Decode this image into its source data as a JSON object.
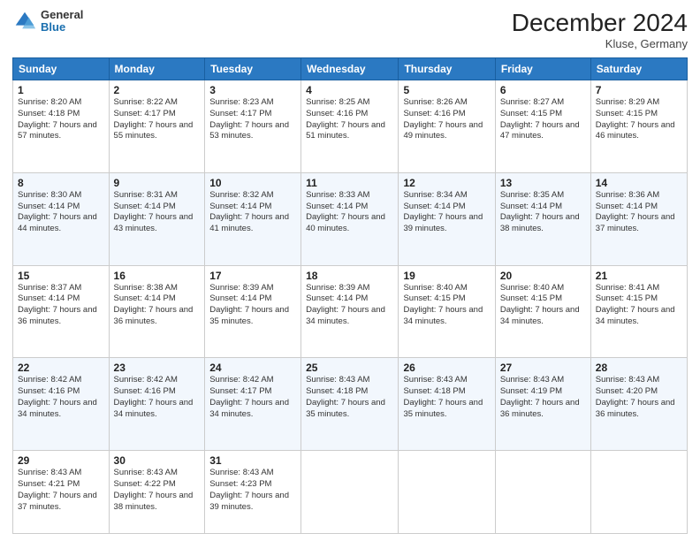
{
  "header": {
    "logo_general": "General",
    "logo_blue": "Blue",
    "month_title": "December 2024",
    "location": "Kluse, Germany"
  },
  "weekdays": [
    "Sunday",
    "Monday",
    "Tuesday",
    "Wednesday",
    "Thursday",
    "Friday",
    "Saturday"
  ],
  "weeks": [
    [
      {
        "day": "1",
        "sunrise": "8:20 AM",
        "sunset": "4:18 PM",
        "daylight": "7 hours and 57 minutes."
      },
      {
        "day": "2",
        "sunrise": "8:22 AM",
        "sunset": "4:17 PM",
        "daylight": "7 hours and 55 minutes."
      },
      {
        "day": "3",
        "sunrise": "8:23 AM",
        "sunset": "4:17 PM",
        "daylight": "7 hours and 53 minutes."
      },
      {
        "day": "4",
        "sunrise": "8:25 AM",
        "sunset": "4:16 PM",
        "daylight": "7 hours and 51 minutes."
      },
      {
        "day": "5",
        "sunrise": "8:26 AM",
        "sunset": "4:16 PM",
        "daylight": "7 hours and 49 minutes."
      },
      {
        "day": "6",
        "sunrise": "8:27 AM",
        "sunset": "4:15 PM",
        "daylight": "7 hours and 47 minutes."
      },
      {
        "day": "7",
        "sunrise": "8:29 AM",
        "sunset": "4:15 PM",
        "daylight": "7 hours and 46 minutes."
      }
    ],
    [
      {
        "day": "8",
        "sunrise": "8:30 AM",
        "sunset": "4:14 PM",
        "daylight": "7 hours and 44 minutes."
      },
      {
        "day": "9",
        "sunrise": "8:31 AM",
        "sunset": "4:14 PM",
        "daylight": "7 hours and 43 minutes."
      },
      {
        "day": "10",
        "sunrise": "8:32 AM",
        "sunset": "4:14 PM",
        "daylight": "7 hours and 41 minutes."
      },
      {
        "day": "11",
        "sunrise": "8:33 AM",
        "sunset": "4:14 PM",
        "daylight": "7 hours and 40 minutes."
      },
      {
        "day": "12",
        "sunrise": "8:34 AM",
        "sunset": "4:14 PM",
        "daylight": "7 hours and 39 minutes."
      },
      {
        "day": "13",
        "sunrise": "8:35 AM",
        "sunset": "4:14 PM",
        "daylight": "7 hours and 38 minutes."
      },
      {
        "day": "14",
        "sunrise": "8:36 AM",
        "sunset": "4:14 PM",
        "daylight": "7 hours and 37 minutes."
      }
    ],
    [
      {
        "day": "15",
        "sunrise": "8:37 AM",
        "sunset": "4:14 PM",
        "daylight": "7 hours and 36 minutes."
      },
      {
        "day": "16",
        "sunrise": "8:38 AM",
        "sunset": "4:14 PM",
        "daylight": "7 hours and 36 minutes."
      },
      {
        "day": "17",
        "sunrise": "8:39 AM",
        "sunset": "4:14 PM",
        "daylight": "7 hours and 35 minutes."
      },
      {
        "day": "18",
        "sunrise": "8:39 AM",
        "sunset": "4:14 PM",
        "daylight": "7 hours and 34 minutes."
      },
      {
        "day": "19",
        "sunrise": "8:40 AM",
        "sunset": "4:15 PM",
        "daylight": "7 hours and 34 minutes."
      },
      {
        "day": "20",
        "sunrise": "8:40 AM",
        "sunset": "4:15 PM",
        "daylight": "7 hours and 34 minutes."
      },
      {
        "day": "21",
        "sunrise": "8:41 AM",
        "sunset": "4:15 PM",
        "daylight": "7 hours and 34 minutes."
      }
    ],
    [
      {
        "day": "22",
        "sunrise": "8:42 AM",
        "sunset": "4:16 PM",
        "daylight": "7 hours and 34 minutes."
      },
      {
        "day": "23",
        "sunrise": "8:42 AM",
        "sunset": "4:16 PM",
        "daylight": "7 hours and 34 minutes."
      },
      {
        "day": "24",
        "sunrise": "8:42 AM",
        "sunset": "4:17 PM",
        "daylight": "7 hours and 34 minutes."
      },
      {
        "day": "25",
        "sunrise": "8:43 AM",
        "sunset": "4:18 PM",
        "daylight": "7 hours and 35 minutes."
      },
      {
        "day": "26",
        "sunrise": "8:43 AM",
        "sunset": "4:18 PM",
        "daylight": "7 hours and 35 minutes."
      },
      {
        "day": "27",
        "sunrise": "8:43 AM",
        "sunset": "4:19 PM",
        "daylight": "7 hours and 36 minutes."
      },
      {
        "day": "28",
        "sunrise": "8:43 AM",
        "sunset": "4:20 PM",
        "daylight": "7 hours and 36 minutes."
      }
    ],
    [
      {
        "day": "29",
        "sunrise": "8:43 AM",
        "sunset": "4:21 PM",
        "daylight": "7 hours and 37 minutes."
      },
      {
        "day": "30",
        "sunrise": "8:43 AM",
        "sunset": "4:22 PM",
        "daylight": "7 hours and 38 minutes."
      },
      {
        "day": "31",
        "sunrise": "8:43 AM",
        "sunset": "4:23 PM",
        "daylight": "7 hours and 39 minutes."
      },
      null,
      null,
      null,
      null
    ]
  ]
}
